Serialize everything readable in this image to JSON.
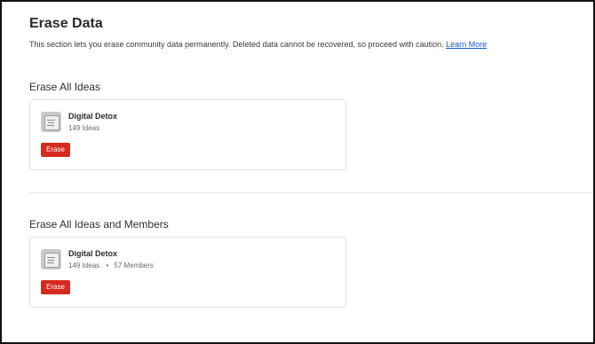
{
  "page": {
    "title": "Erase Data",
    "intro_text": "This section lets you erase community data permanently. Deleted data cannot be recovered, so proceed with caution.",
    "learn_more_label": "Learn More"
  },
  "sections": [
    {
      "title": "Erase All Ideas",
      "community": {
        "name": "Digital Detox",
        "ideas": "149 Ideas"
      },
      "erase_label": "Erase"
    },
    {
      "title": "Erase All Ideas and Members",
      "community": {
        "name": "Digital Detox",
        "ideas": "149 Ideas",
        "separator": "•",
        "members": "57 Members"
      },
      "erase_label": "Erase"
    }
  ],
  "colors": {
    "erase_button": "#d72a1f",
    "link": "#1a56c9"
  }
}
